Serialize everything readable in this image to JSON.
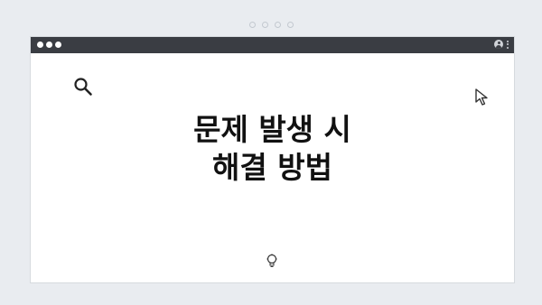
{
  "icons": {
    "search": "search-icon",
    "cursor": "cursor-arrow-icon",
    "bulb": "lightbulb-icon",
    "user": "user-icon",
    "menu": "kebab-menu-icon"
  },
  "colors": {
    "titlebar": "#3a3d43",
    "background": "#e9ecf0",
    "window": "#ffffff",
    "text": "#111111"
  },
  "main": {
    "title_line1": "문제 발생 시",
    "title_line2": "해결 방법"
  }
}
